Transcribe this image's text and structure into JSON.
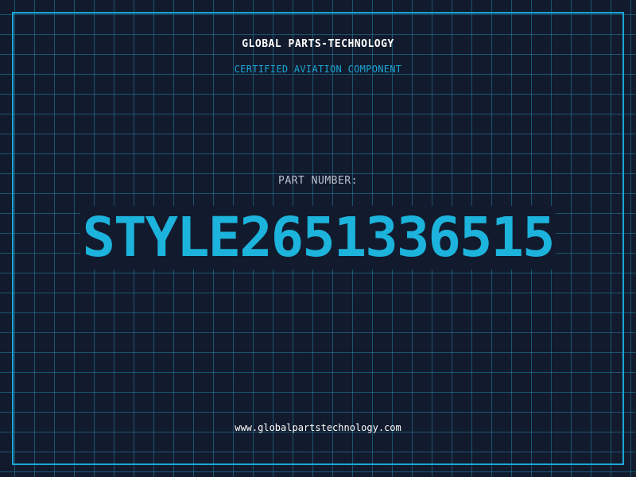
{
  "header": {
    "company": "GLOBAL PARTS-TECHNOLOGY",
    "subtitle": "CERTIFIED AVIATION COMPONENT"
  },
  "main": {
    "label": "PART NUMBER:",
    "part_number": "STYLE2651336515"
  },
  "footer": {
    "url": "www.globalpartstechnology.com"
  },
  "colors": {
    "background": "#121b2d",
    "accent": "#1aa6d6",
    "part_number": "#1cb3dc",
    "label": "#b7c3cf",
    "text": "#ffffff"
  }
}
